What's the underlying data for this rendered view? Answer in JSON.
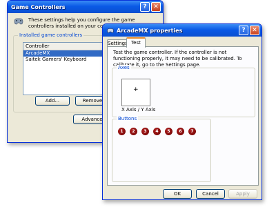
{
  "back_window": {
    "title": "Game Controllers",
    "description": "These settings help you configure the game controllers installed on your computer.",
    "group_label": "Installed game controllers",
    "column_header": "Controller",
    "controllers": [
      "ArcadeMX",
      "Saitek Gamers' Keyboard"
    ],
    "add_label": "Add...",
    "remove_label": "Remove",
    "advanced_label": "Advance"
  },
  "front_window": {
    "title": "ArcadeMX properties",
    "tabs": [
      "Settings",
      "Test"
    ],
    "active_tab": "Test",
    "instructions": "Test the game controller.  If the controller is not functioning properly, it may need to be calibrated.  To calibrate it, go to the Settings page.",
    "axes_label": "Axes",
    "axes_caption": "X Axis / Y Axis",
    "buttons_label": "Buttons",
    "buttons": [
      "1",
      "2",
      "3",
      "4",
      "5",
      "6",
      "7"
    ],
    "ok_label": "OK",
    "cancel_label": "Cancel",
    "apply_label": "Apply"
  },
  "colors": {
    "titlebar": "#0a5ae6",
    "group_label": "#0046d5",
    "selected_row": "#316ac5",
    "button_indicator": "#8b0000"
  },
  "icons": [
    "gamepad-icon",
    "help-icon",
    "close-icon",
    "crosshair-icon"
  ]
}
